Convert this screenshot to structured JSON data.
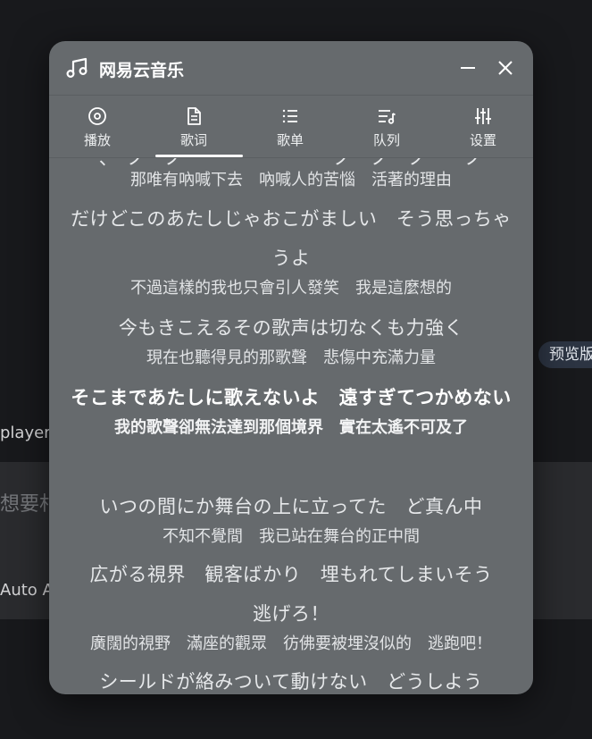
{
  "background": {
    "player_label": "player",
    "search_placeholder": "想要村",
    "auto_label": "Auto Ap",
    "preview_badge": "预览版"
  },
  "window": {
    "title": "网易云音乐",
    "icons": {
      "app": "music-note-icon",
      "minimize": "minimize-icon",
      "close": "close-icon"
    }
  },
  "tabs": [
    {
      "label": "播放",
      "icon": "disc-icon",
      "active": false
    },
    {
      "label": "歌词",
      "icon": "document-icon",
      "active": true
    },
    {
      "label": "歌单",
      "icon": "list-icon",
      "active": false
    },
    {
      "label": "队列",
      "icon": "queue-icon",
      "active": false
    },
    {
      "label": "设置",
      "icon": "sliders-icon",
      "active": false
    }
  ],
  "lyrics": {
    "partial_top": "、　ノ　ノ　　　　　　　　ノ　ノ　ノ　　ノ",
    "lines": [
      {
        "jp": "",
        "zh": "那唯有吶喊下去　吶喊人的苦惱　活著的理由",
        "active": false
      },
      {
        "jp": "だけどこのあたしじゃおこがましい　そう思っちゃうよ",
        "zh": "不過這樣的我也只會引人發笑　我是這麼想的",
        "active": false
      },
      {
        "jp": "今もきこえるその歌声は切なくも力強く",
        "zh": "現在也聽得見的那歌聲　悲傷中充滿力量",
        "active": false
      },
      {
        "jp": "そこまであたしに歌えないよ　遠すぎてつかめない",
        "zh": "我的歌聲卻無法達到那個境界　實在太遙不可及了",
        "active": true
      },
      {
        "jp": "いつの間にか舞台の上に立ってた　ど真ん中",
        "zh": "不知不覺間　我已站在舞台的正中間",
        "active": false
      },
      {
        "jp": "広がる視界　観客ばかり　埋もれてしまいそう　逃げろ！",
        "zh": "廣闊的視野　滿座的觀眾　彷佛要被埋沒似的　逃跑吧！",
        "active": false
      },
      {
        "jp": "シールドが絡みついて動けない　どうしよう",
        "zh": "",
        "active": false
      }
    ]
  }
}
